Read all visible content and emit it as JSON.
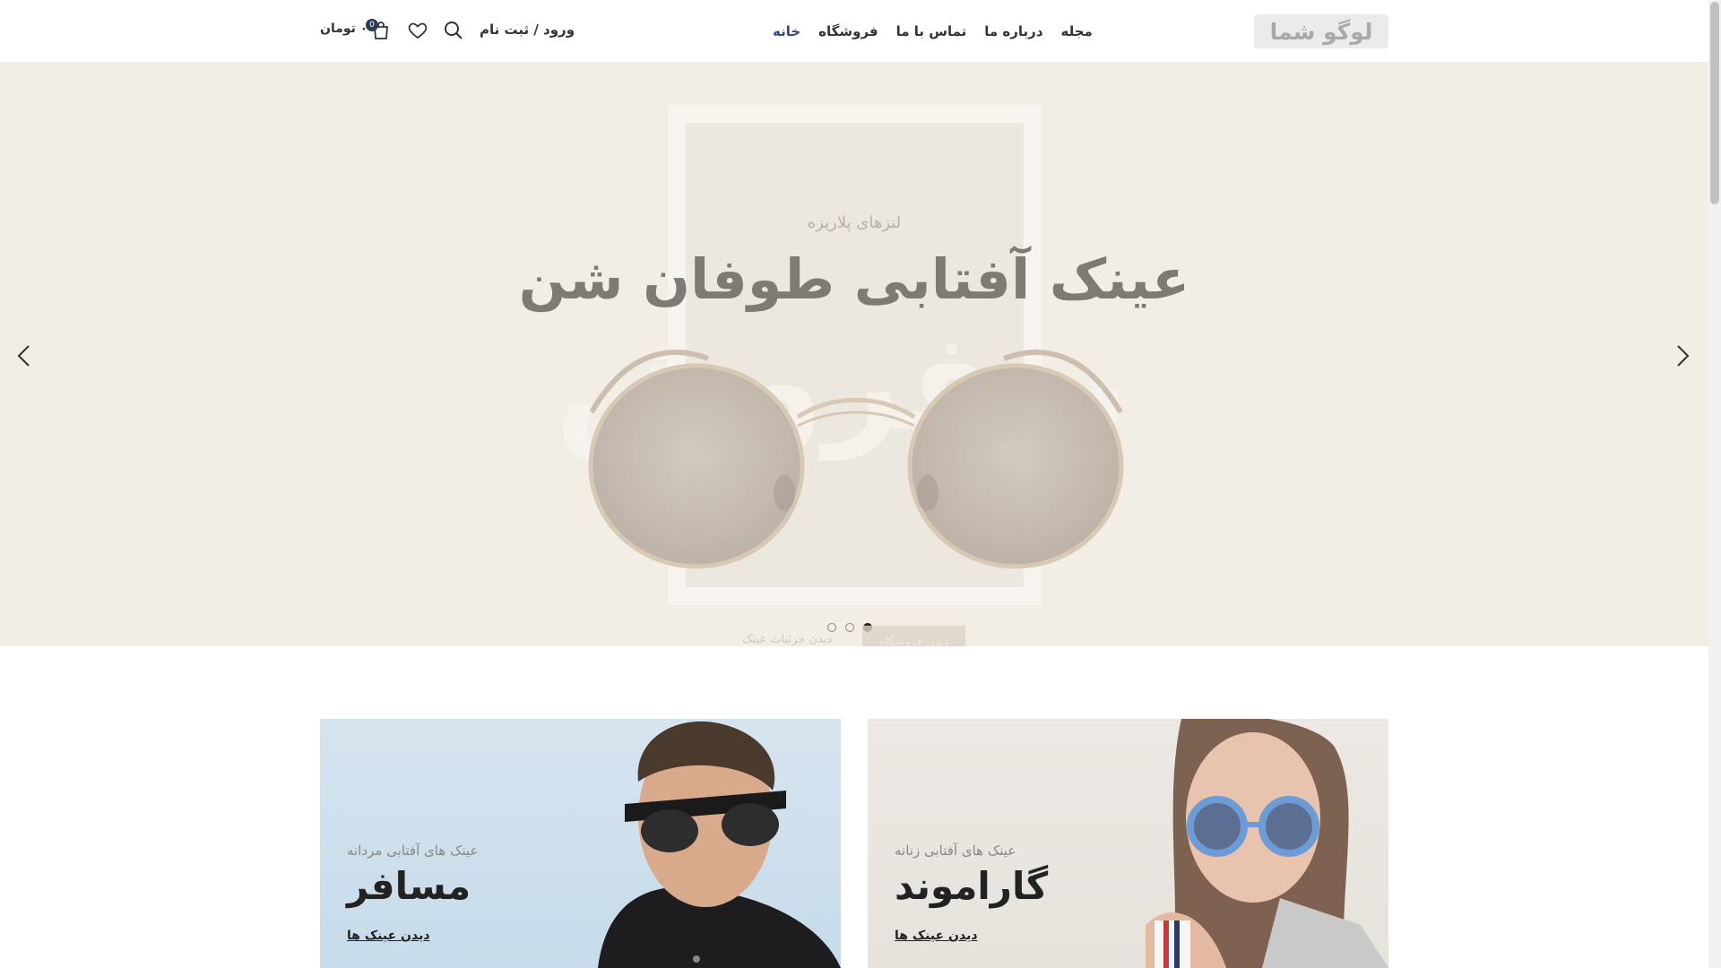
{
  "header": {
    "logo_text": "لوگو شما",
    "nav": [
      {
        "label": "خانه",
        "active": true
      },
      {
        "label": "فروشگاه",
        "active": false
      },
      {
        "label": "تماس با ما",
        "active": false
      },
      {
        "label": "درباره ما",
        "active": false
      },
      {
        "label": "مجله",
        "active": false
      }
    ],
    "account_label": "ورود / ثبت نام",
    "cart_count": "0",
    "cart_total": "۰ تومان",
    "icons": [
      "search-icon",
      "heart-icon",
      "bag-icon"
    ]
  },
  "hero": {
    "subtitle": "لنزهای پلاریزه",
    "title": "عینک آفتابی طوفان شن",
    "watermark": "پرفروش",
    "cta_label": "دیدن فروشگاه",
    "details_label": "دیدن جزئیات عینک",
    "slides": 3,
    "active_slide": 1
  },
  "cards": [
    {
      "label": "عینک های آفتابی زنانه",
      "name": "گاراموند",
      "link": "دیدن عینک ها"
    },
    {
      "label": "عینک های آفتابی مردانه",
      "name": "مسافر",
      "link": "دیدن عینک ها"
    }
  ],
  "colors": {
    "hero_bg": "#f2ede5",
    "accent": "#3b3f8f",
    "badge": "#2a3b55"
  }
}
